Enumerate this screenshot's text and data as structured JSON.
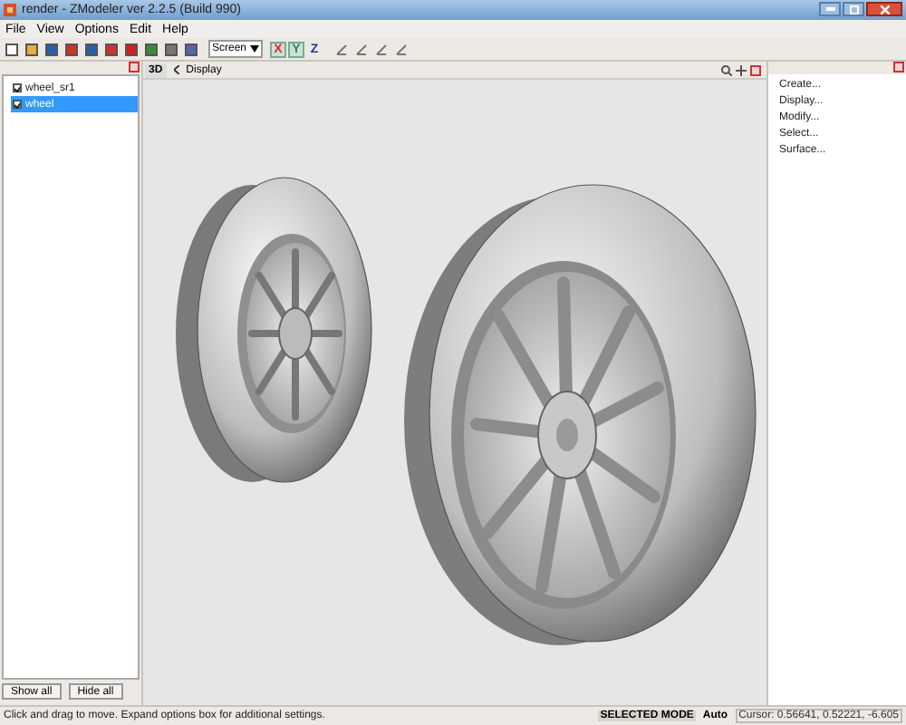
{
  "window": {
    "title": "render - ZModeler ver 2.2.5 (Build 990)"
  },
  "menu": [
    "File",
    "View",
    "Options",
    "Edit",
    "Help"
  ],
  "toolbar": {
    "view_mode": "Screen",
    "axes": [
      {
        "label": "X",
        "selected": true
      },
      {
        "label": "Y",
        "selected": true
      },
      {
        "label": "Z",
        "selected": false
      }
    ]
  },
  "objects": [
    {
      "name": "wheel_sr1",
      "checked": true,
      "selected": false
    },
    {
      "name": "wheel",
      "checked": true,
      "selected": true
    }
  ],
  "buttons": [
    "Show all",
    "Hide all"
  ],
  "viewport": {
    "mode": "3D",
    "label": "Display"
  },
  "commands": [
    "Create...",
    "Display...",
    "Modify...",
    "Select...",
    "Surface..."
  ],
  "status_bar": {
    "hint": "Click and drag to move. Expand options box for additional settings.",
    "mode": "SELECTED MODE",
    "snap": "Auto",
    "cursor": "Cursor: 0.56641, 0.52221, -6.605"
  }
}
